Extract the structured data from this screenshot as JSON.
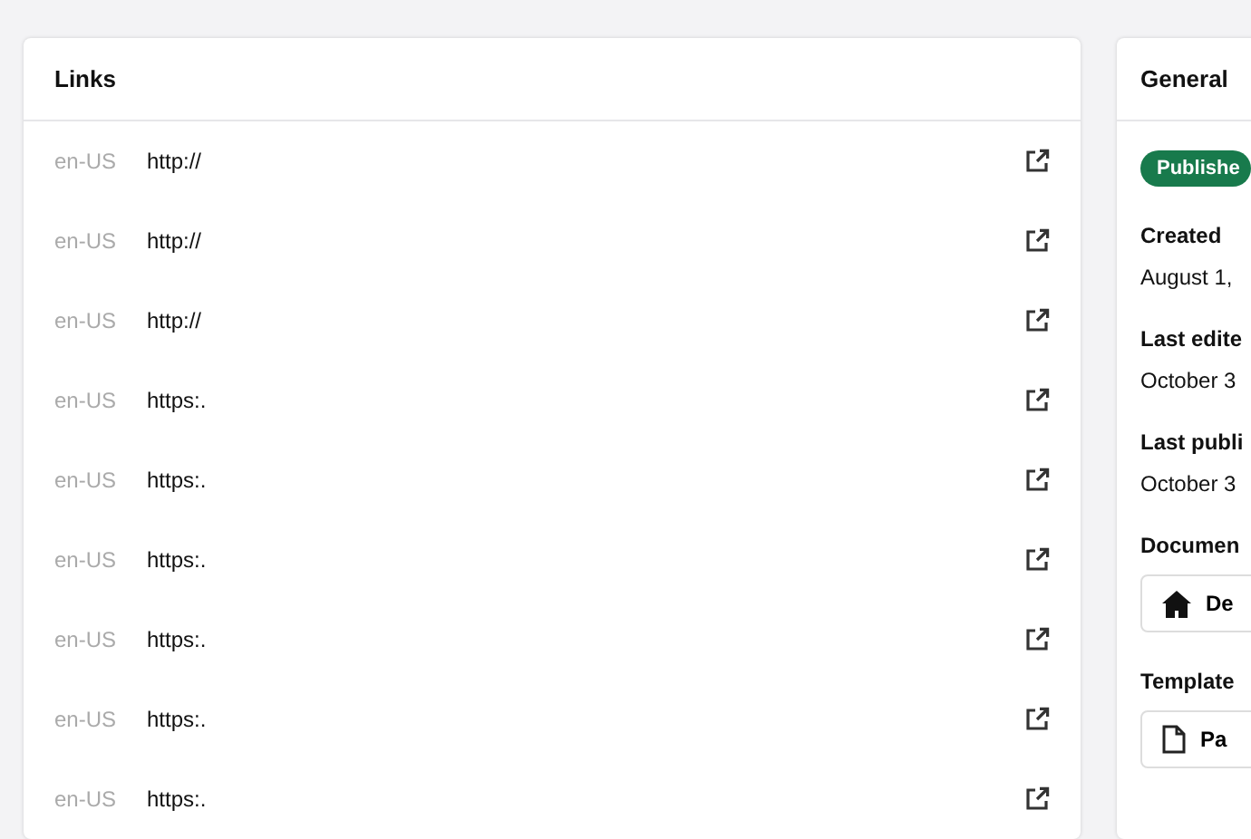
{
  "links": {
    "title": "Links",
    "rows": [
      {
        "locale": "en-US",
        "url": "http://"
      },
      {
        "locale": "en-US",
        "url": "http://"
      },
      {
        "locale": "en-US",
        "url": "http://"
      },
      {
        "locale": "en-US",
        "url": "https:."
      },
      {
        "locale": "en-US",
        "url": "https:."
      },
      {
        "locale": "en-US",
        "url": "https:."
      },
      {
        "locale": "en-US",
        "url": "https:."
      },
      {
        "locale": "en-US",
        "url": "https:."
      },
      {
        "locale": "en-US",
        "url": "https:."
      }
    ]
  },
  "general": {
    "title": "General",
    "status": "Publishe",
    "fields": [
      {
        "kind": "text",
        "label": "Created",
        "value": "August 1,"
      },
      {
        "kind": "text",
        "label": "Last edite",
        "value": "October 3"
      },
      {
        "kind": "text",
        "label": "Last publi",
        "value": "October 3"
      },
      {
        "kind": "home",
        "label": "Documen",
        "value": "De"
      },
      {
        "kind": "file",
        "label": "Template",
        "value": "Pa"
      }
    ]
  }
}
